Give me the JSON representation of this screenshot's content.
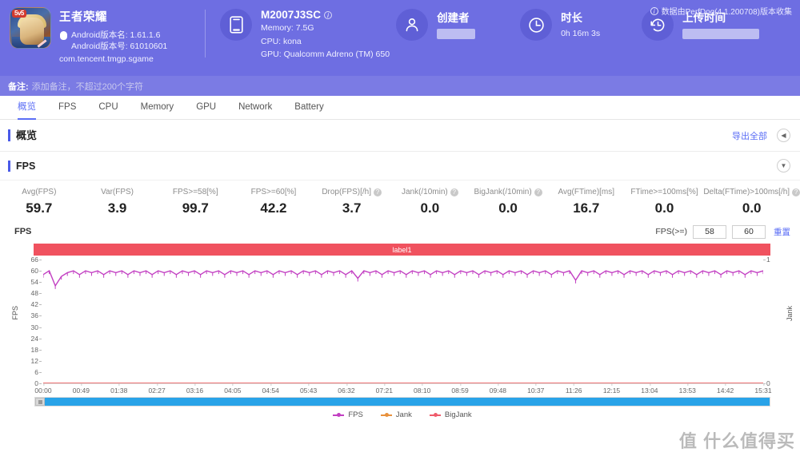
{
  "header": {
    "game": {
      "name": "王者荣耀",
      "version_name": "Android版本名: 1.61.1.6",
      "version_code": "Android版本号: 61010601",
      "package": "com.tencent.tmgp.sgame",
      "icon": "game-app-icon",
      "android_icon": "android-icon"
    },
    "device": {
      "model": "M2007J3SC",
      "memory": "Memory: 7.5G",
      "cpu": "CPU: kona",
      "gpu": "GPU: Qualcomm Adreno (TM) 650",
      "icon": "phone-icon",
      "info_icon": "info-icon"
    },
    "creator": {
      "title": "创建者",
      "value": "",
      "icon": "user-icon"
    },
    "duration": {
      "title": "时长",
      "value": "0h 16m 3s",
      "icon": "clock-icon"
    },
    "upload_time": {
      "title": "上传时间",
      "value": "",
      "icon": "history-icon"
    },
    "perfdog_note": "数据由PerfDog(4.1.200708)版本收集",
    "remark_label": "备注:",
    "remark_placeholder": "添加备注，不超过200个字符"
  },
  "tabs": [
    {
      "label": "概览",
      "active": true
    },
    {
      "label": "FPS",
      "active": false
    },
    {
      "label": "CPU",
      "active": false
    },
    {
      "label": "Memory",
      "active": false
    },
    {
      "label": "GPU",
      "active": false
    },
    {
      "label": "Network",
      "active": false
    },
    {
      "label": "Battery",
      "active": false
    }
  ],
  "overview": {
    "title": "概览",
    "export_label": "导出全部",
    "collapse_icon": "chevron-left-icon"
  },
  "fps_panel": {
    "title": "FPS",
    "expand_icon": "chevron-down-icon",
    "metrics": [
      {
        "label": "Avg(FPS)",
        "value": "59.7",
        "help": false
      },
      {
        "label": "Var(FPS)",
        "value": "3.9",
        "help": false
      },
      {
        "label": "FPS>=58[%]",
        "value": "99.7",
        "help": false
      },
      {
        "label": "FPS>=60[%]",
        "value": "42.2",
        "help": false
      },
      {
        "label": "Drop(FPS)[/h]",
        "value": "3.7",
        "help": true
      },
      {
        "label": "Jank(/10min)",
        "value": "0.0",
        "help": true
      },
      {
        "label": "BigJank(/10min)",
        "value": "0.0",
        "help": true
      },
      {
        "label": "Avg(FTime)[ms]",
        "value": "16.7",
        "help": false
      },
      {
        "label": "FTime>=100ms[%]",
        "value": "0.0",
        "help": false
      },
      {
        "label": "Delta(FTime)>100ms[/h]",
        "value": "0.0",
        "help": true
      }
    ],
    "chart_label": "FPS",
    "threshold_label": "FPS(>=)",
    "threshold_low": "58",
    "threshold_high": "60",
    "reset_label": "重置"
  },
  "chart_data": {
    "type": "line",
    "title": "FPS",
    "band_label": "label1",
    "xlabel": "",
    "ylabel": "FPS",
    "y2label": "Jank",
    "ylim": [
      0,
      66
    ],
    "y2lim": [
      0,
      1
    ],
    "grid": false,
    "legend_position": "bottom",
    "yticks": [
      0,
      6,
      12,
      18,
      24,
      30,
      36,
      42,
      48,
      54,
      60,
      66
    ],
    "y2ticks": [
      0,
      1
    ],
    "xticks": [
      "00:00",
      "00:49",
      "01:38",
      "02:27",
      "03:16",
      "04:05",
      "04:54",
      "05:43",
      "06:32",
      "07:21",
      "08:10",
      "08:59",
      "09:48",
      "10:37",
      "11:26",
      "12:15",
      "13:04",
      "13:53",
      "14:42",
      "15:31"
    ],
    "series": [
      {
        "name": "FPS",
        "color": "#c23fc2",
        "axis": "left",
        "values": [
          58,
          60,
          52,
          57,
          59,
          60,
          58,
          60,
          59,
          60,
          58,
          60,
          59,
          60,
          58,
          60,
          59,
          60,
          58,
          60,
          59,
          60,
          58,
          60,
          59,
          60,
          58,
          60,
          59,
          60,
          58,
          60,
          59,
          60,
          58,
          60,
          59,
          60,
          58,
          60,
          59,
          60,
          58,
          60,
          59,
          60,
          58,
          60,
          59,
          60,
          58,
          60,
          56,
          60,
          59,
          60,
          58,
          60,
          59,
          60,
          58,
          60,
          59,
          60,
          58,
          60,
          59,
          60,
          58,
          60,
          59,
          60,
          58,
          60,
          59,
          60,
          58,
          60,
          59,
          60,
          58,
          60,
          59,
          60,
          58,
          60,
          59,
          60,
          55,
          60,
          59,
          60,
          58,
          60,
          59,
          60,
          58,
          60,
          59,
          60,
          58,
          60,
          59,
          60,
          58,
          60,
          59,
          60,
          58,
          60,
          59,
          60,
          58,
          60,
          59,
          60,
          58,
          60,
          59,
          60
        ]
      },
      {
        "name": "Jank",
        "color": "#e8913c",
        "axis": "right",
        "values": [
          0,
          0,
          0,
          0,
          0,
          0,
          0,
          0,
          0,
          0,
          0,
          0,
          0,
          0,
          0,
          0,
          0,
          0,
          0,
          0,
          0,
          0,
          0,
          0,
          0,
          0,
          0,
          0,
          0,
          0,
          0,
          0,
          0,
          0,
          0,
          0,
          0,
          0,
          0,
          0,
          0,
          0,
          0,
          0,
          0,
          0,
          0,
          0,
          0,
          0,
          0,
          0,
          0,
          0,
          0,
          0,
          0,
          0,
          0,
          0,
          0,
          0,
          0,
          0,
          0,
          0,
          0,
          0,
          0,
          0,
          0,
          0,
          0,
          0,
          0,
          0,
          0,
          0,
          0,
          0,
          0,
          0,
          0,
          0,
          0,
          0,
          0,
          0,
          0,
          0,
          0,
          0,
          0,
          0,
          0,
          0,
          0,
          0,
          0,
          0,
          0,
          0,
          0,
          0,
          0,
          0,
          0,
          0,
          0,
          0,
          0,
          0,
          0,
          0,
          0,
          0,
          0,
          0,
          0,
          0
        ]
      },
      {
        "name": "BigJank",
        "color": "#ef5b6b",
        "axis": "right",
        "values": [
          0,
          0,
          0,
          0,
          0,
          0,
          0,
          0,
          0,
          0,
          0,
          0,
          0,
          0,
          0,
          0,
          0,
          0,
          0,
          0,
          0,
          0,
          0,
          0,
          0,
          0,
          0,
          0,
          0,
          0,
          0,
          0,
          0,
          0,
          0,
          0,
          0,
          0,
          0,
          0,
          0,
          0,
          0,
          0,
          0,
          0,
          0,
          0,
          0,
          0,
          0,
          0,
          0,
          0,
          0,
          0,
          0,
          0,
          0,
          0,
          0,
          0,
          0,
          0,
          0,
          0,
          0,
          0,
          0,
          0,
          0,
          0,
          0,
          0,
          0,
          0,
          0,
          0,
          0,
          0,
          0,
          0,
          0,
          0,
          0,
          0,
          0,
          0,
          0,
          0,
          0,
          0,
          0,
          0,
          0,
          0,
          0,
          0,
          0,
          0,
          0,
          0,
          0,
          0,
          0,
          0,
          0,
          0,
          0,
          0,
          0,
          0,
          0,
          0,
          0,
          0,
          0,
          0,
          0,
          0
        ]
      }
    ],
    "legend": [
      {
        "name": "FPS",
        "color": "#c23fc2"
      },
      {
        "name": "Jank",
        "color": "#e8913c"
      },
      {
        "name": "BigJank",
        "color": "#ef5b6b"
      }
    ]
  },
  "watermark": "值 什么值得买"
}
